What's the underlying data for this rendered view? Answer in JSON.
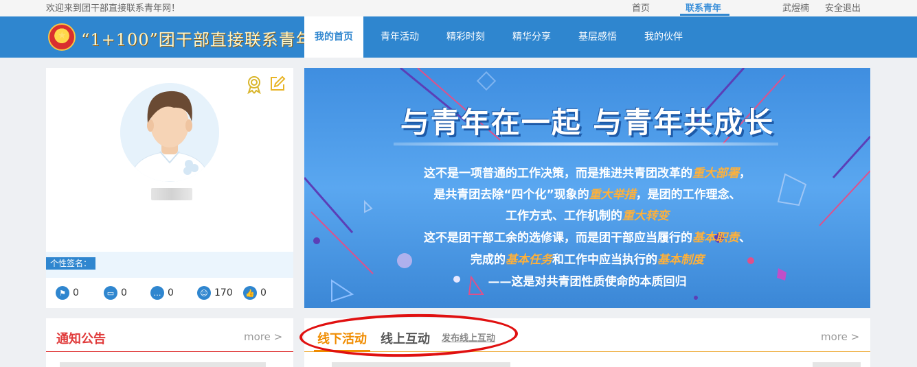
{
  "topbar": {
    "welcome": "欢迎来到团干部直接联系青年网！",
    "links": [
      "首页",
      "联系青年"
    ],
    "user": "武煜楠",
    "logout": "安全退出"
  },
  "nav": {
    "site_title": "“1+100”团干部直接联系青年",
    "items": [
      "我的首页",
      "青年活动",
      "精彩时刻",
      "精华分享",
      "基层感悟",
      "我的伙伴"
    ]
  },
  "profile": {
    "sign_label": "个性签名：",
    "stats": [
      {
        "icon": "flag-icon",
        "value": "0"
      },
      {
        "icon": "monitor-icon",
        "value": "0"
      },
      {
        "icon": "chat-icon",
        "value": "0"
      },
      {
        "icon": "user-icon",
        "value": "170"
      },
      {
        "icon": "thumbs-up-icon",
        "value": "0"
      }
    ]
  },
  "banner": {
    "title": "与青年在一起 与青年共成长",
    "lines": [
      [
        "这不是一项普通的工作决策，而是推进共青团改革的",
        "重大部署",
        "，"
      ],
      [
        "是共青团去除“四个化”现象的",
        "重大举措",
        "，是团的工作理念、"
      ],
      [
        "工作方式、工作机制的",
        "重大转变",
        ""
      ],
      [
        "这不是团干部工余的选修课，而是团干部应当履行的",
        "基本职责",
        "、"
      ],
      [
        "完成的",
        "基本任务",
        "和工作中应当执行的",
        "基本制度"
      ],
      [
        "——这是对共青团性质使命的本质回归"
      ]
    ]
  },
  "notice": {
    "title": "通知公告",
    "more": "more >"
  },
  "activity": {
    "tabs": [
      "线下活动",
      "线上互动"
    ],
    "publish": "发布线上互动",
    "more": "more >"
  },
  "colors": {
    "primary": "#2f86cf",
    "accent_orange": "#f08c00",
    "notice_red": "#e03b3b",
    "annotation_red": "#e01010"
  }
}
